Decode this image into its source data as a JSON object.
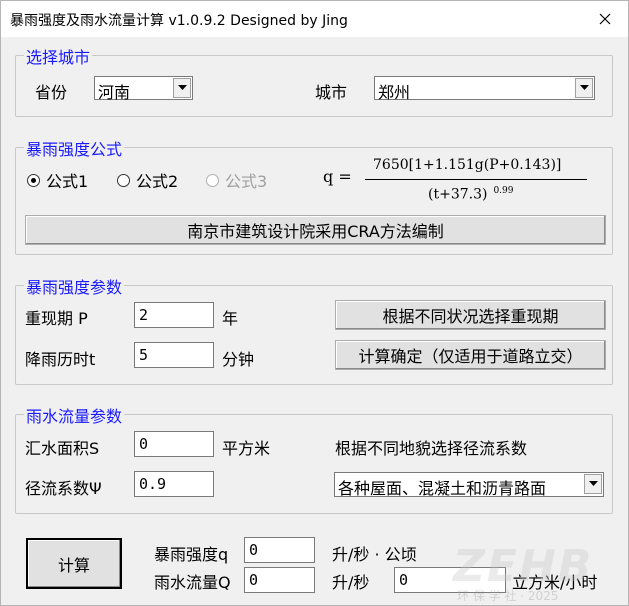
{
  "window": {
    "title": "暴雨强度及雨水流量计算 v1.0.9.2 Designed by Jing"
  },
  "city_group": {
    "title": "选择城市",
    "province_label": "省份",
    "province_value": "河南",
    "city_label": "城市",
    "city_value": "郑州"
  },
  "formula_group": {
    "title": "暴雨强度公式",
    "radios": [
      {
        "label": "公式1",
        "checked": true,
        "enabled": true
      },
      {
        "label": "公式2",
        "checked": false,
        "enabled": true
      },
      {
        "label": "公式3",
        "checked": false,
        "enabled": false
      }
    ],
    "formula_lhs": "q  =",
    "formula_numerator": "7650[1+1.151g(P+0.143)]",
    "formula_denominator": "(t+37.3)",
    "formula_exponent": "0.99",
    "source_button": "南京市建筑设计院采用CRA方法编制"
  },
  "params_group": {
    "title": "暴雨强度参数",
    "period_label": "重现期  P",
    "period_value": "2",
    "period_unit": "年",
    "period_button": "根据不同状况选择重现期",
    "duration_label": "降雨历时t",
    "duration_value": "5",
    "duration_unit": "分钟",
    "duration_button": "计算确定（仅适用于道路立交）"
  },
  "flow_group": {
    "title": "雨水流量参数",
    "area_label": "汇水面积S",
    "area_value": "0",
    "area_unit": "平方米",
    "coef_hint": "根据不同地貌选择径流系数",
    "coef_label": "径流系数Ψ",
    "coef_value": "0.9",
    "surface_value": "各种屋面、混凝土和沥青路面"
  },
  "results": {
    "calc_button": "计算",
    "intensity_label": "暴雨强度q",
    "intensity_value": "0",
    "intensity_unit": "升/秒 · 公顷",
    "flow_label": "雨水流量Q",
    "flow_value": "0",
    "flow_unit": "升/秒",
    "flow_value2": "0",
    "flow_unit2": "立方米/小时"
  },
  "watermark": {
    "big": "ZEHB",
    "small": "环 保 学 社 · 2025"
  }
}
